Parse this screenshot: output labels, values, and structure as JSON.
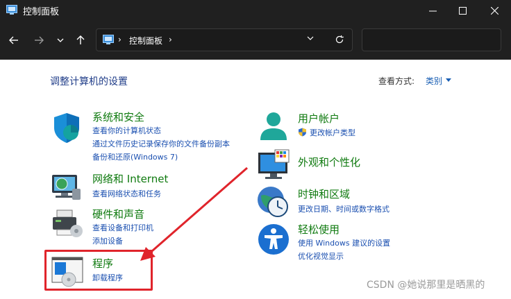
{
  "window": {
    "title": "控制面板"
  },
  "address_bar": {
    "path": "控制面板",
    "separator": "›"
  },
  "search": {
    "placeholder": ""
  },
  "content": {
    "heading": "调整计算机的设置",
    "view_by_label": "查看方式:",
    "view_by_value": "类别"
  },
  "categories": [
    {
      "title": "系统和安全",
      "links": [
        "查看你的计算机状态",
        "通过文件历史记录保存你的文件备份副本",
        "备份和还原(Windows 7)"
      ],
      "icon": "system-security-icon"
    },
    {
      "title": "网络和 Internet",
      "links": [
        "查看网络状态和任务"
      ],
      "icon": "network-icon"
    },
    {
      "title": "硬件和声音",
      "links": [
        "查看设备和打印机",
        "添加设备"
      ],
      "icon": "hardware-sound-icon"
    },
    {
      "title": "程序",
      "links": [
        "卸载程序"
      ],
      "icon": "programs-icon"
    },
    {
      "title": "用户帐户",
      "links": [
        "更改帐户类型"
      ],
      "icon": "user-accounts-icon"
    },
    {
      "title": "外观和个性化",
      "links": [],
      "icon": "appearance-icon"
    },
    {
      "title": "时钟和区域",
      "links": [
        "更改日期、时间或数字格式"
      ],
      "icon": "clock-region-icon"
    },
    {
      "title": "轻松使用",
      "links": [
        "使用 Windows 建议的设置",
        "优化视觉显示"
      ],
      "icon": "ease-of-access-icon"
    }
  ],
  "annotation": {
    "highlight_color": "#e0242b"
  },
  "watermark": "CSDN @她说那里是晒黑的",
  "colors": {
    "titlebar": "#202020",
    "category_title": "#0f7a0f",
    "link": "#1a4fb0",
    "heading": "#1f3c88"
  }
}
